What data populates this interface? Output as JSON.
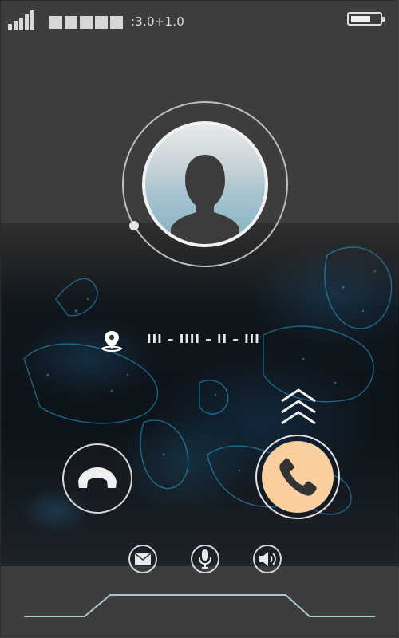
{
  "status_bar": {
    "signal_bars": 5,
    "carrier_placeholder_blocks": 5,
    "version_text": ":3.0+1.0",
    "battery_level_percent": 70
  },
  "caller": {
    "location_icon": "location-pin-icon",
    "number_text": "III – IIII – II – III"
  },
  "controls": {
    "decline_icon": "hang-up-phone-icon",
    "accept_icon": "phone-handset-icon",
    "swipe_hint_icon": "double-chevron-up-icon",
    "actions": [
      {
        "icon": "message-envelope-icon"
      },
      {
        "icon": "microphone-icon"
      },
      {
        "icon": "speaker-icon"
      }
    ]
  },
  "colors": {
    "background": "#3d3d3d",
    "accept_button": "#f9cf9f",
    "map_glow": "#2a9fd0"
  }
}
